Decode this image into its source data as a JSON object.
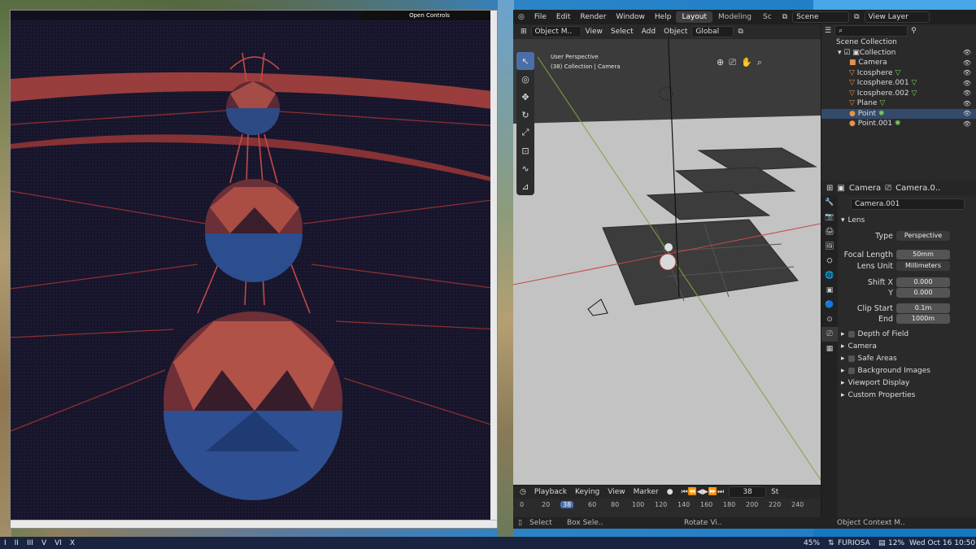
{
  "render_window": {
    "title": "Open Controls"
  },
  "blender": {
    "menu": [
      "File",
      "Edit",
      "Render",
      "Window",
      "Help"
    ],
    "workspaces": [
      "Layout",
      "Modeling",
      "Sc"
    ],
    "scene": "Scene",
    "view_layer": "View Layer",
    "viewport": {
      "mode": "Object M..",
      "menus": [
        "View",
        "Select",
        "Add",
        "Object"
      ],
      "transform": "Global",
      "perspective": "User Perspective",
      "collection_info": "(38) Collection | Camera"
    },
    "outliner": {
      "root": "Scene Collection",
      "collection": "Collection",
      "items": [
        "Camera",
        "Icosphere",
        "Icosphere.001",
        "Icosphere.002",
        "Plane",
        "Point",
        "Point.001"
      ],
      "selected": "Point"
    },
    "properties": {
      "object": "Camera",
      "data": "Camera.0..",
      "datablock": "Camera.001",
      "lens_section": "Lens",
      "type_label": "Type",
      "type_value": "Perspective",
      "focal_label": "Focal Length",
      "focal_value": "50mm",
      "lens_unit_label": "Lens Unit",
      "lens_unit_value": "Millimeters",
      "shift_x_label": "Shift X",
      "shift_x_value": "0.000",
      "y_label": "Y",
      "y_value": "0.000",
      "clip_start_label": "Clip Start",
      "clip_start_value": "0.1m",
      "end_label": "End",
      "end_value": "1000m",
      "sections": [
        "Depth of Field",
        "Camera",
        "Safe Areas",
        "Background Images",
        "Viewport Display",
        "Custom Properties"
      ]
    },
    "timeline": {
      "menus": [
        "Playback",
        "Keying",
        "View",
        "Marker"
      ],
      "current_frame": "38",
      "ticks": [
        "0",
        "20",
        "38",
        "60",
        "80",
        "100",
        "120",
        "140",
        "160",
        "180",
        "200",
        "220",
        "240"
      ],
      "end_label": "St"
    },
    "status": [
      "Select",
      "Box Sele..",
      "Rotate Vi..",
      "Object Context M.."
    ]
  },
  "taskbar": {
    "workspaces": [
      "I",
      "II",
      "III",
      "V",
      "VI",
      "X"
    ],
    "battery": "45%",
    "network": "FURIOSA",
    "cpu": "12%",
    "datetime": "Wed Oct 16 10:50"
  }
}
